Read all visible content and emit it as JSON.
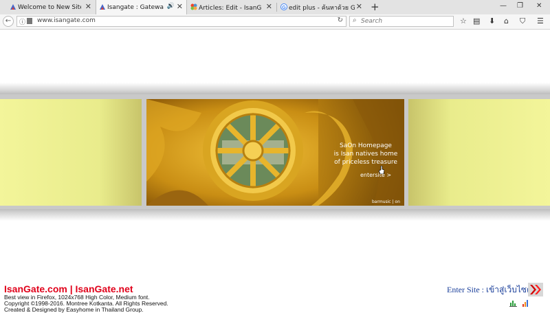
{
  "browser": {
    "tabs": [
      {
        "title": "Welcome to New Site - Isan"
      },
      {
        "title": "Isangate : Gateway to Nor",
        "active": true
      },
      {
        "title": "Articles: Edit - IsanGate : ประ"
      },
      {
        "title": "edit plus - ค้นหาด้วย Google"
      }
    ],
    "new_tab": "+",
    "window": {
      "minimize": "—",
      "restore": "❐",
      "close": "✕"
    },
    "url": "www.isangate.com",
    "search_placeholder": "Search",
    "icons": [
      "back-icon",
      "info-icon",
      "reload-icon",
      "search-icon",
      "bookmark-star-icon",
      "reading-list-icon",
      "download-icon",
      "home-icon",
      "pocket-icon",
      "menu-icon"
    ]
  },
  "hero": {
    "text_line1": "SaOn Homepage",
    "text_line2": "is Isan natives home",
    "text_line3": "of priceless treasure",
    "enter": "entersite >",
    "brand": "barmusic | on"
  },
  "footer": {
    "brand": "IsanGate.com | IsanGate.net",
    "line1": "Best view in Firefox, 1024x768 High Color, Medium font.",
    "line2": "Copyright ©1998-2016. Montree Kotkanta. All Rights Reserved.",
    "line3": "Created & Designed by Easyhome in Thailand Group.",
    "enter_site": "Enter Site : เข้าสู่เว็บไซต์"
  },
  "colors": {
    "brand_red": "#e0001a",
    "link_blue": "#1a3f9a",
    "gold": "#d4a017"
  }
}
